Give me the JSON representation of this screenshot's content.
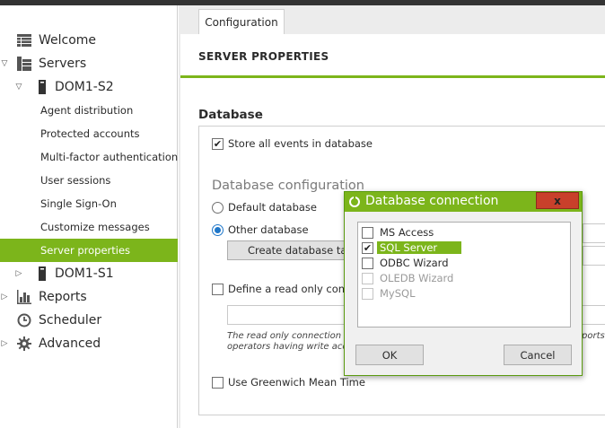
{
  "sidebar": {
    "items": [
      {
        "label": "Welcome",
        "icon": "grid-icon"
      },
      {
        "label": "Servers",
        "icon": "server-rack-icon",
        "expanded": true
      },
      {
        "label": "DOM1-S2",
        "icon": "server-icon",
        "expanded": true
      },
      {
        "label": "Agent distribution"
      },
      {
        "label": "Protected accounts"
      },
      {
        "label": "Multi-factor authentication"
      },
      {
        "label": "User sessions"
      },
      {
        "label": "Single Sign-On"
      },
      {
        "label": "Customize messages"
      },
      {
        "label": "Server properties",
        "selected": true
      },
      {
        "label": "DOM1-S1",
        "icon": "server-icon",
        "expanded": false
      },
      {
        "label": "Reports",
        "icon": "bar-chart-icon",
        "expanded": false
      },
      {
        "label": "Scheduler",
        "icon": "clock-icon"
      },
      {
        "label": "Advanced",
        "icon": "gear-icon",
        "expanded": false
      }
    ]
  },
  "tabs": [
    {
      "label": "Configuration",
      "active": true
    }
  ],
  "page": {
    "title": "SERVER PROPERTIES",
    "section_title": "Database",
    "store_all_events_label": "Store all events in database",
    "store_all_events_checked": true,
    "db_config_heading": "Database configuration",
    "default_db_label": "Default database",
    "other_db_label": "Other database",
    "selected_db_option": "Other database",
    "create_tables_button": "Create database table",
    "read_only_label": "Define a read only conne",
    "read_only_checked": false,
    "note_line1": "The read only connection s",
    "note_line2": "operators having write acce",
    "note_right": "ports",
    "gmt_label": "Use Greenwich Mean Time",
    "gmt_checked": false
  },
  "dialog": {
    "title": "Database connection",
    "close_label": "x",
    "options": [
      {
        "label": "MS Access",
        "checked": false,
        "enabled": true
      },
      {
        "label": "SQL Server",
        "checked": true,
        "enabled": true,
        "selected": true
      },
      {
        "label": "ODBC Wizard",
        "checked": false,
        "enabled": true
      },
      {
        "label": "OLEDB Wizard",
        "checked": false,
        "enabled": false
      },
      {
        "label": "MySQL",
        "checked": false,
        "enabled": false
      }
    ],
    "ok_label": "OK",
    "cancel_label": "Cancel"
  },
  "colors": {
    "accent": "#7cb51b",
    "close": "#c9402b",
    "radio": "#1f77c9"
  }
}
